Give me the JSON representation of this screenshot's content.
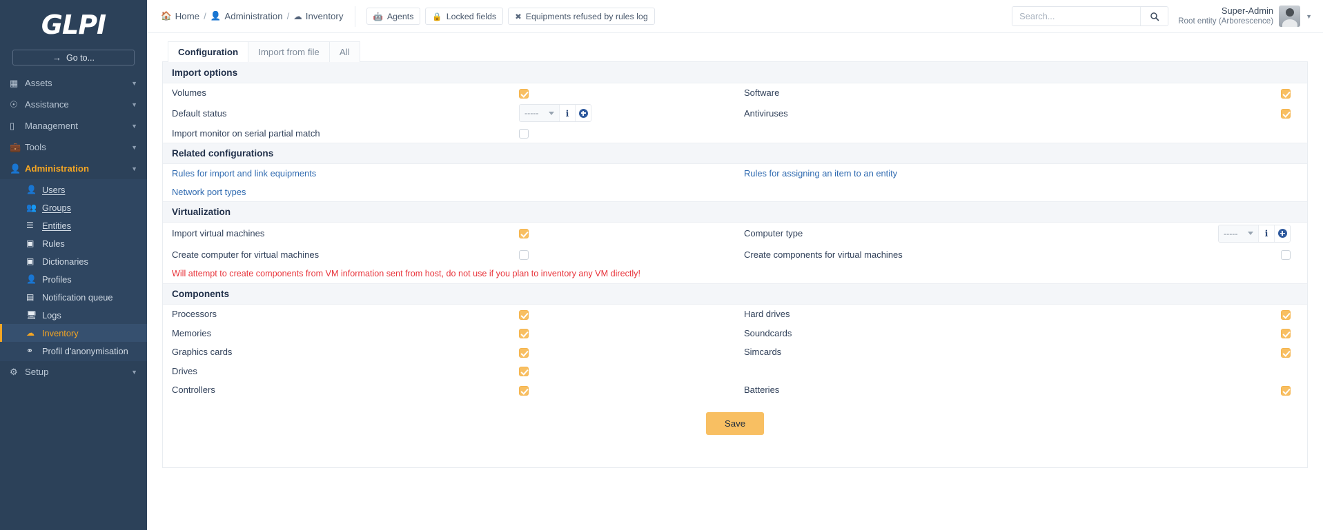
{
  "brand": {
    "logo_text": "GLPI",
    "goto_label": "Go to..."
  },
  "sidebar": {
    "top_items": [
      {
        "label": "Assets",
        "icon": "assets-icon"
      },
      {
        "label": "Assistance",
        "icon": "assistance-icon"
      },
      {
        "label": "Management",
        "icon": "management-icon"
      },
      {
        "label": "Tools",
        "icon": "tools-icon"
      },
      {
        "label": "Administration",
        "icon": "administration-icon"
      }
    ],
    "sub_items": [
      {
        "label": "Users",
        "icon": "user-icon"
      },
      {
        "label": "Groups",
        "icon": "group-icon"
      },
      {
        "label": "Entities",
        "icon": "layers-icon"
      },
      {
        "label": "Rules",
        "icon": "book-icon"
      },
      {
        "label": "Dictionaries",
        "icon": "book-icon"
      },
      {
        "label": "Profiles",
        "icon": "user-check-icon"
      },
      {
        "label": "Notification queue",
        "icon": "list-icon"
      },
      {
        "label": "Logs",
        "icon": "monitor-icon"
      },
      {
        "label": "Inventory",
        "icon": "cloud-download-icon"
      },
      {
        "label": "Profil d'anonymisation",
        "icon": "mask-icon"
      }
    ],
    "bottom_item": {
      "label": "Setup",
      "icon": "gears-icon"
    }
  },
  "header": {
    "breadcrumb": [
      {
        "label": "Home",
        "icon": "home-icon"
      },
      {
        "label": "Administration",
        "icon": "administration-icon"
      },
      {
        "label": "Inventory",
        "icon": "cloud-download-icon"
      }
    ],
    "separator": "/",
    "buttons": [
      {
        "label": "Agents",
        "icon": "robot-icon"
      },
      {
        "label": "Locked fields",
        "icon": "lock-icon"
      },
      {
        "label": "Equipments refused by rules log",
        "icon": "close-x-icon"
      }
    ],
    "search": {
      "placeholder": "Search...",
      "value": "",
      "icon": "search-icon"
    },
    "user": {
      "name": "Super-Admin",
      "entity": "Root entity (Arborescence)"
    }
  },
  "tabs": [
    {
      "label": "Configuration",
      "active": true
    },
    {
      "label": "Import from file",
      "active": false
    },
    {
      "label": "All",
      "active": false
    }
  ],
  "sections": {
    "import_options": {
      "title": "Import options",
      "left": [
        {
          "label": "Volumes",
          "type": "checkbox",
          "checked": true
        },
        {
          "label": "Default status",
          "type": "dropdown",
          "value": "-----"
        },
        {
          "label": "Import monitor on serial partial match",
          "type": "checkbox",
          "checked": false
        }
      ],
      "right": [
        {
          "label": "Software",
          "type": "checkbox",
          "checked": true
        },
        {
          "label": "Antiviruses",
          "type": "checkbox",
          "checked": true
        }
      ]
    },
    "related_configurations": {
      "title": "Related configurations",
      "left": [
        {
          "label": "Rules for import and link equipments"
        },
        {
          "label": "Network port types"
        }
      ],
      "right": [
        {
          "label": "Rules for assigning an item to an entity"
        }
      ]
    },
    "virtualization": {
      "title": "Virtualization",
      "left": [
        {
          "label": "Import virtual machines",
          "type": "checkbox",
          "checked": true
        },
        {
          "label": "Create computer for virtual machines",
          "type": "checkbox",
          "checked": false
        }
      ],
      "right": [
        {
          "label": "Computer type",
          "type": "dropdown",
          "value": "-----"
        },
        {
          "label": "Create components for virtual machines",
          "type": "checkbox",
          "checked": false
        }
      ],
      "warning": "Will attempt to create components from VM information sent from host, do not use if you plan to inventory any VM directly!"
    },
    "components": {
      "title": "Components",
      "left": [
        {
          "label": "Processors",
          "checked": true
        },
        {
          "label": "Memories",
          "checked": true
        },
        {
          "label": "Graphics cards",
          "checked": true
        },
        {
          "label": "Drives",
          "checked": true
        },
        {
          "label": "Controllers",
          "checked": true
        }
      ],
      "right": [
        {
          "label": "Hard drives",
          "checked": true
        },
        {
          "label": "Soundcards",
          "checked": true
        },
        {
          "label": "Simcards",
          "checked": true
        },
        {
          "label": "",
          "checked": null
        },
        {
          "label": "Batteries",
          "checked": true
        }
      ]
    }
  },
  "footer": {
    "save_label": "Save"
  },
  "colors": {
    "sidebar_bg": "#2c4159",
    "accent": "#f5a623",
    "checkbox_on": "#f8bf62",
    "link": "#2f6ab0",
    "warning": "#e8333a"
  }
}
